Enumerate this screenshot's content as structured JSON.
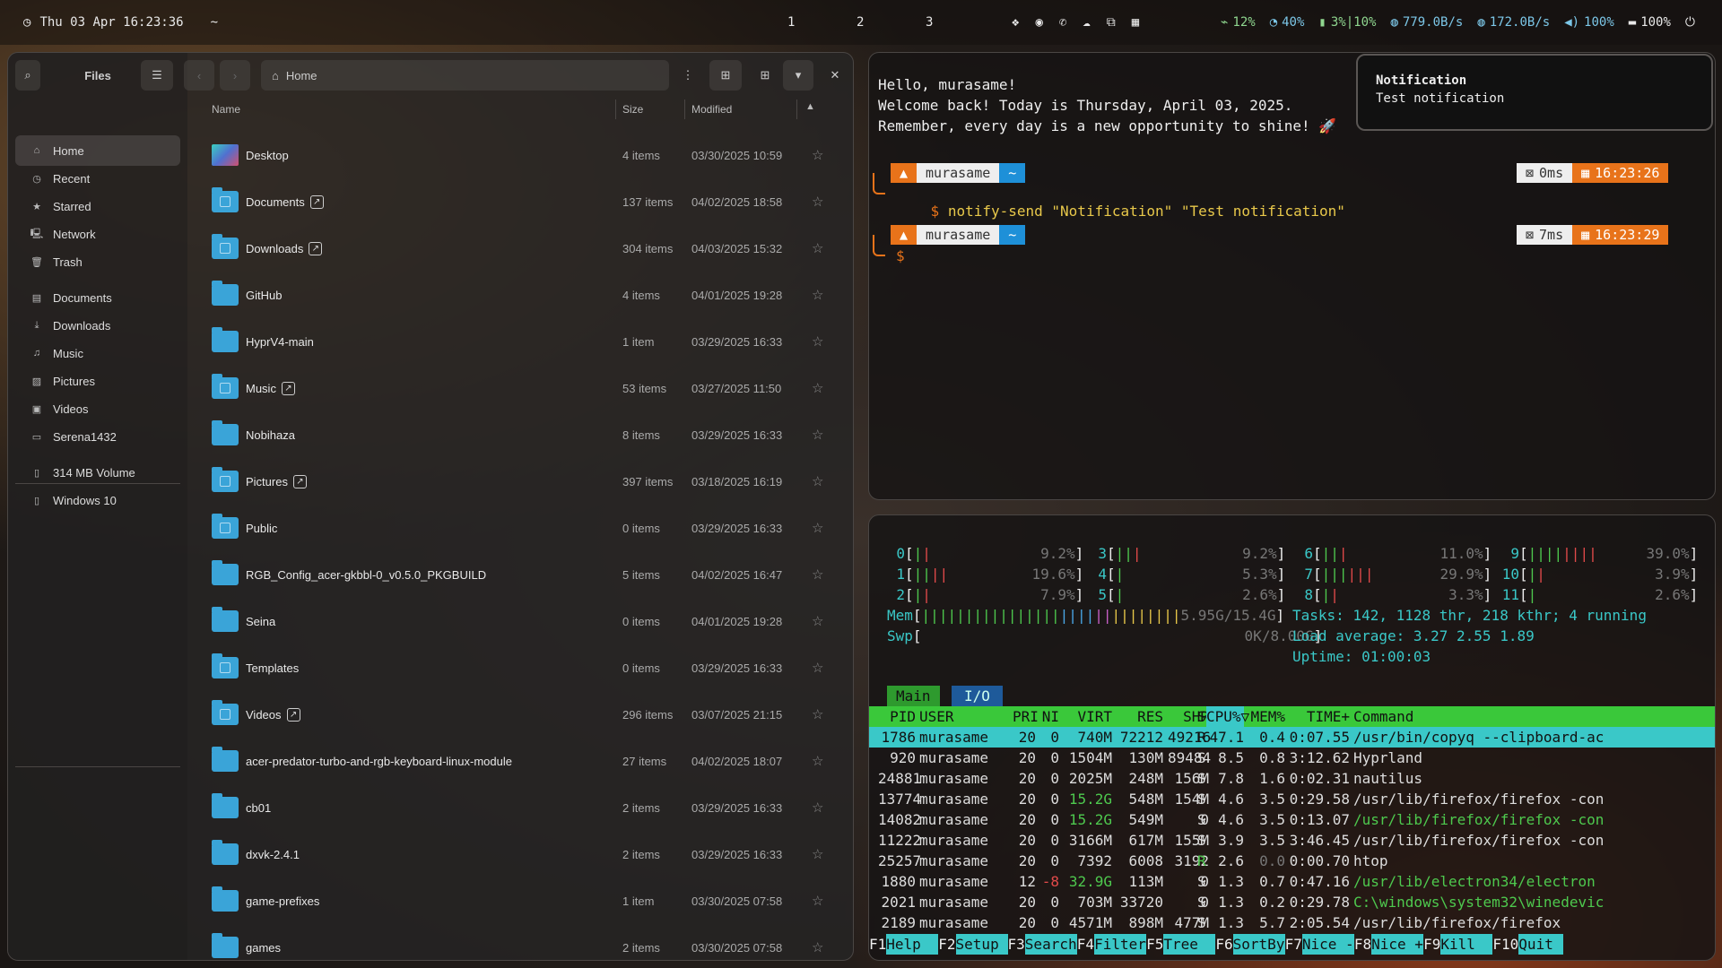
{
  "topbar": {
    "clock": "Thu 03 Apr 16:23:36",
    "tilde": "~",
    "workspaces": [
      "1",
      "2",
      "3"
    ],
    "stats": {
      "cpu": "12%",
      "mem": "40%",
      "disk": "3%|10%",
      "down": "779.0B/s",
      "up": "172.0B/s",
      "volume": "100%",
      "battery": "100%"
    }
  },
  "files": {
    "title": "Files",
    "location": "Home",
    "sidebar": [
      {
        "label": "Home",
        "icon": "home-icon"
      },
      {
        "label": "Recent",
        "icon": "clock-icon"
      },
      {
        "label": "Starred",
        "icon": "star-icon"
      },
      {
        "label": "Network",
        "icon": "network-icon"
      },
      {
        "label": "Trash",
        "icon": "trash-icon"
      },
      {
        "label": "Documents",
        "icon": "document-icon"
      },
      {
        "label": "Downloads",
        "icon": "download-icon"
      },
      {
        "label": "Music",
        "icon": "music-icon"
      },
      {
        "label": "Pictures",
        "icon": "picture-icon"
      },
      {
        "label": "Videos",
        "icon": "video-icon"
      },
      {
        "label": "Serena1432",
        "icon": "folder-icon"
      },
      {
        "label": "314 MB Volume",
        "icon": "drive-icon"
      },
      {
        "label": "Windows 10",
        "icon": "drive-icon"
      }
    ],
    "columns": {
      "name": "Name",
      "size": "Size",
      "modified": "Modified"
    },
    "rows": [
      {
        "name": "Desktop",
        "size": "4 items",
        "modified": "03/30/2025 10:59"
      },
      {
        "name": "Documents",
        "size": "137 items",
        "modified": "04/02/2025 18:58",
        "link": true
      },
      {
        "name": "Downloads",
        "size": "304 items",
        "modified": "04/03/2025 15:32",
        "link": true
      },
      {
        "name": "GitHub",
        "size": "4 items",
        "modified": "04/01/2025 19:28"
      },
      {
        "name": "HyprV4-main",
        "size": "1 item",
        "modified": "03/29/2025 16:33"
      },
      {
        "name": "Music",
        "size": "53 items",
        "modified": "03/27/2025 11:50",
        "link": true
      },
      {
        "name": "Nobihaza",
        "size": "8 items",
        "modified": "03/29/2025 16:33"
      },
      {
        "name": "Pictures",
        "size": "397 items",
        "modified": "03/18/2025 16:19",
        "link": true
      },
      {
        "name": "Public",
        "size": "0 items",
        "modified": "03/29/2025 16:33"
      },
      {
        "name": "RGB_Config_acer-gkbbl-0_v0.5.0_PKGBUILD",
        "size": "5 items",
        "modified": "04/02/2025 16:47"
      },
      {
        "name": "Seina",
        "size": "0 items",
        "modified": "04/01/2025 19:28"
      },
      {
        "name": "Templates",
        "size": "0 items",
        "modified": "03/29/2025 16:33"
      },
      {
        "name": "Videos",
        "size": "296 items",
        "modified": "03/07/2025 21:15",
        "link": true
      },
      {
        "name": "acer-predator-turbo-and-rgb-keyboard-linux-module",
        "size": "27 items",
        "modified": "04/02/2025 18:07"
      },
      {
        "name": "cb01",
        "size": "2 items",
        "modified": "03/29/2025 16:33"
      },
      {
        "name": "dxvk-2.4.1",
        "size": "2 items",
        "modified": "03/29/2025 16:33"
      },
      {
        "name": "game-prefixes",
        "size": "1 item",
        "modified": "03/30/2025 07:58"
      },
      {
        "name": "games",
        "size": "2 items",
        "modified": "03/30/2025 07:58"
      }
    ]
  },
  "terminal": {
    "greeting": [
      "Hello, murasame!",
      "Welcome back! Today is Thursday, April 03, 2025.",
      "Remember, every day is a new opportunity to shine! 🚀"
    ],
    "prompt_user": "murasame",
    "prompt_dir": "~",
    "prompt_sym": "$",
    "command": "notify-send \"Notification\" \"Test notification\"",
    "p1_duration": "0ms",
    "p1_time": "16:23:26",
    "p2_duration": "7ms",
    "p2_time": "16:23:29"
  },
  "notification": {
    "title": "Notification",
    "body": "Test notification"
  },
  "htop": {
    "cpus": [
      {
        "id": "0",
        "val": "9.2%"
      },
      {
        "id": "1",
        "val": "19.6%"
      },
      {
        "id": "2",
        "val": "7.9%"
      },
      {
        "id": "3",
        "val": "9.2%"
      },
      {
        "id": "4",
        "val": "5.3%"
      },
      {
        "id": "5",
        "val": "2.6%"
      },
      {
        "id": "6",
        "val": "11.0%"
      },
      {
        "id": "7",
        "val": "29.9%"
      },
      {
        "id": "8",
        "val": "3.3%"
      },
      {
        "id": "9",
        "val": "39.0%"
      },
      {
        "id": "10",
        "val": "3.9%"
      },
      {
        "id": "11",
        "val": "2.6%"
      }
    ],
    "mem_label": "Mem",
    "mem_val": "5.95G/15.4G",
    "swp_label": "Swp",
    "swp_val": "0K/8.00G",
    "tasks": "Tasks: 142, 1128 thr, 218 kthr; 4 running",
    "load": "Load average: 3.27 2.55 1.89",
    "uptime": "Uptime: 01:00:03",
    "tabs": [
      "Main",
      "I/O"
    ],
    "header": [
      "PID",
      "USER",
      "PRI",
      "NI",
      "VIRT",
      "RES",
      "SHR",
      "S",
      "CPU%▽",
      "MEM%",
      "TIME+",
      "Command"
    ],
    "procs": [
      [
        "1786",
        "murasame",
        "20",
        "0",
        "740M",
        "72212",
        "49216",
        "R",
        "47.1",
        "0.4",
        "0:07.55",
        "/usr/bin/copyq --clipboard-ac"
      ],
      [
        "920",
        "murasame",
        "20",
        "0",
        "1504M",
        "130M",
        "89484",
        "S",
        "8.5",
        "0.8",
        "3:12.62",
        "Hyprland"
      ],
      [
        "24881",
        "murasame",
        "20",
        "0",
        "2025M",
        "248M",
        "156M",
        "S",
        "7.8",
        "1.6",
        "0:02.31",
        "nautilus"
      ],
      [
        "13774",
        "murasame",
        "20",
        "0",
        "15.2G",
        "548M",
        "154M",
        "S",
        "4.6",
        "3.5",
        "0:29.58",
        "/usr/lib/firefox/firefox -con"
      ],
      [
        "14082",
        "murasame",
        "20",
        "0",
        "15.2G",
        "549M",
        "0",
        "S",
        "4.6",
        "3.5",
        "0:13.07",
        "/usr/lib/firefox/firefox -con"
      ],
      [
        "11222",
        "murasame",
        "20",
        "0",
        "3166M",
        "617M",
        "155M",
        "S",
        "3.9",
        "3.5",
        "3:46.45",
        "/usr/lib/firefox/firefox -con"
      ],
      [
        "25257",
        "murasame",
        "20",
        "0",
        "7392",
        "6008",
        "3192",
        "R",
        "2.6",
        "0.0",
        "0:00.70",
        "htop"
      ],
      [
        "1880",
        "murasame",
        "12",
        "-8",
        "32.9G",
        "113M",
        "0",
        "S",
        "1.3",
        "0.7",
        "0:47.16",
        "/usr/lib/electron34/electron"
      ],
      [
        "2021",
        "murasame",
        "20",
        "0",
        "703M",
        "33720",
        "0",
        "S",
        "1.3",
        "0.2",
        "0:29.78",
        "C:\\windows\\system32\\winedevic"
      ],
      [
        "2189",
        "murasame",
        "20",
        "0",
        "4571M",
        "898M",
        "477M",
        "S",
        "1.3",
        "5.7",
        "2:05.54",
        "/usr/lib/firefox/firefox"
      ]
    ],
    "fkeys": [
      [
        "F1",
        "Help"
      ],
      [
        "F2",
        "Setup"
      ],
      [
        "F3",
        "Search"
      ],
      [
        "F4",
        "Filter"
      ],
      [
        "F5",
        "Tree"
      ],
      [
        "F6",
        "SortBy"
      ],
      [
        "F7",
        "Nice -"
      ],
      [
        "F8",
        "Nice +"
      ],
      [
        "F9",
        "Kill"
      ],
      [
        "F10",
        "Quit"
      ]
    ]
  }
}
